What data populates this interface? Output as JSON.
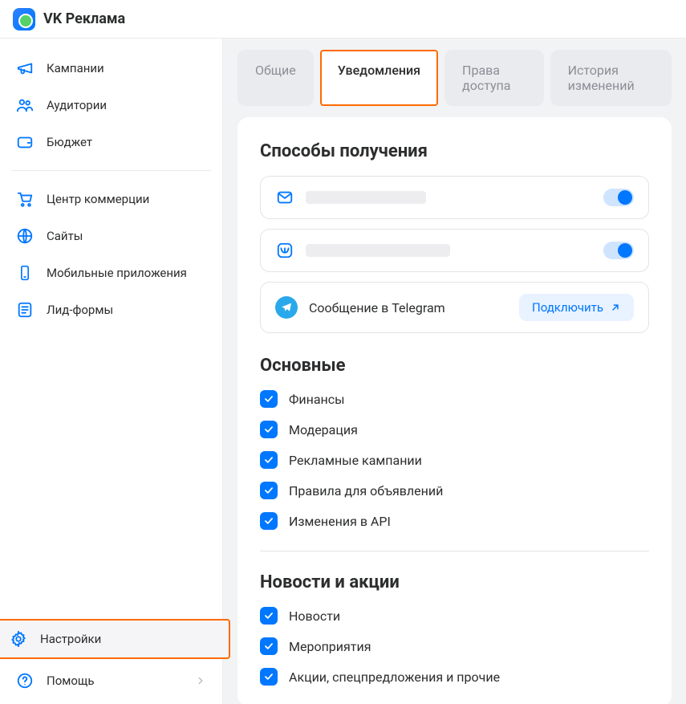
{
  "brand": "VK Реклама",
  "sidebar": {
    "items": [
      {
        "label": "Кампании"
      },
      {
        "label": "Аудитории"
      },
      {
        "label": "Бюджет"
      },
      {
        "label": "Центр коммерции"
      },
      {
        "label": "Сайты"
      },
      {
        "label": "Мобильные приложения"
      },
      {
        "label": "Лид-формы"
      }
    ],
    "bottom": [
      {
        "label": "Настройки",
        "active": true
      },
      {
        "label": "Помощь"
      }
    ]
  },
  "tabs": [
    {
      "label": "Общие"
    },
    {
      "label": "Уведомления",
      "active": true
    },
    {
      "label": "Права доступа"
    },
    {
      "label": "История изменений"
    }
  ],
  "sections": {
    "channels_title": "Способы получения",
    "telegram_label": "Сообщение в Telegram",
    "connect_label": "Подключить",
    "main_title": "Основные",
    "main_items": [
      "Финансы",
      "Модерация",
      "Рекламные кампании",
      "Правила для объявлений",
      "Изменения в API"
    ],
    "news_title": "Новости и акции",
    "news_items": [
      "Новости",
      "Мероприятия",
      "Акции, спецпредложения и прочие"
    ]
  }
}
